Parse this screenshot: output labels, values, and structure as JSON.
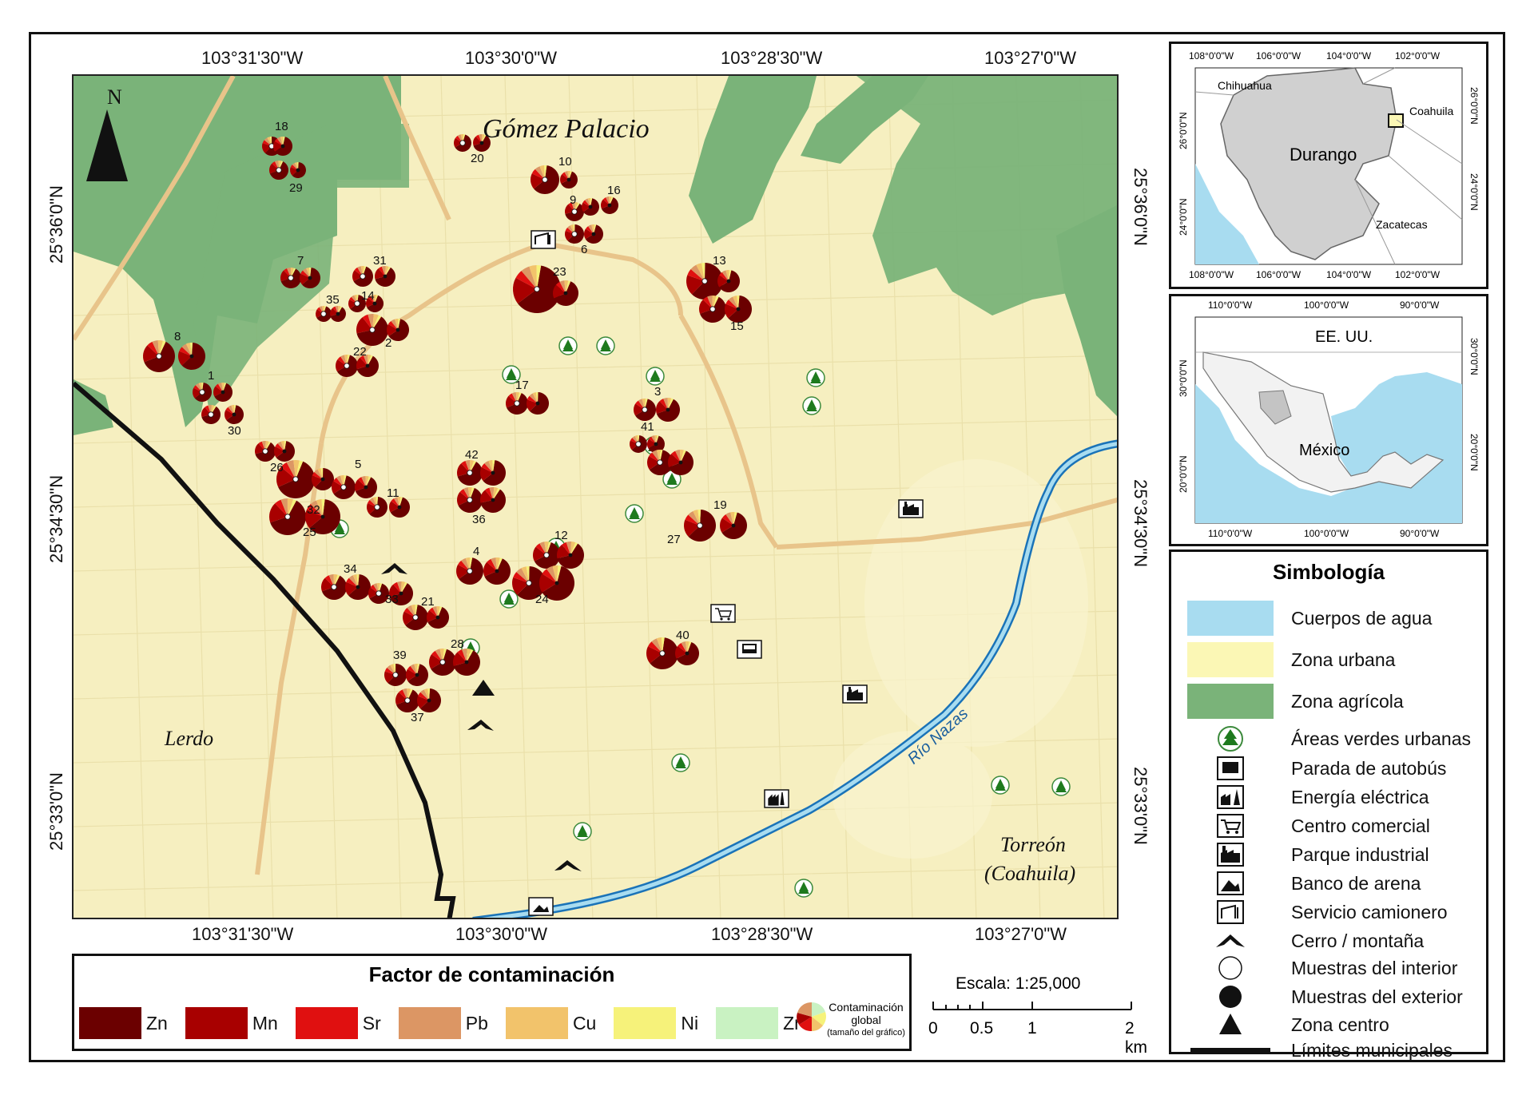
{
  "colors": {
    "water": "#a8dcf0",
    "urban": "#fbf7b5",
    "agri": "#7ab379",
    "zn": "#6b0000",
    "mn": "#a80000",
    "sr": "#e01010",
    "pb": "#dc9664",
    "cu": "#f2c36b",
    "ni": "#f6f27a",
    "zr": "#c9f2c2",
    "border": "#111111",
    "river": "#1a73b8"
  },
  "main_map": {
    "top_coords": [
      "103°31'30\"W",
      "103°30'0\"W",
      "103°28'30\"W",
      "103°27'0\"W"
    ],
    "bottom_coords": [
      "103°31'30\"W",
      "103°30'0\"W",
      "103°28'30\"W",
      "103°27'0\"W"
    ],
    "left_coords": [
      "25°36'0\"N",
      "25°34'30\"N",
      "25°33'0\"N"
    ],
    "right_coords": [
      "25°36'0\"N",
      "25°34'30\"N",
      "25°33'0\"N"
    ],
    "north_label": "N",
    "places": {
      "gomez": "Gómez Palacio",
      "lerdo": "Lerdo",
      "torreon1": "Torreón",
      "torreon2": "(Coahuila)",
      "river": "Río Nazas"
    },
    "site_numbers": [
      "18",
      "29",
      "20",
      "10",
      "9",
      "16",
      "6",
      "7",
      "31",
      "23",
      "13",
      "15",
      "35",
      "14",
      "2",
      "8",
      "22",
      "1",
      "30",
      "17",
      "3",
      "41",
      "26",
      "32",
      "5",
      "11",
      "42",
      "36",
      "27",
      "19",
      "25",
      "12",
      "4",
      "34",
      "33",
      "21",
      "24",
      "39",
      "37",
      "28",
      "40"
    ]
  },
  "inset_durango": {
    "top": [
      "108°0'0\"W",
      "106°0'0\"W",
      "104°0'0\"W",
      "102°0'0\"W"
    ],
    "bottom": [
      "108°0'0\"W",
      "106°0'0\"W",
      "104°0'0\"W",
      "102°0'0\"W"
    ],
    "left": [
      "26°0'0\"N",
      "24°0'0\"N"
    ],
    "right": [
      "26°0'0\"N",
      "24°0'0\"N"
    ],
    "labels": {
      "chihuahua": "Chihuahua",
      "coahuila": "Coahuila",
      "durango": "Durango",
      "zacatecas": "Zacatecas"
    }
  },
  "inset_mexico": {
    "top": [
      "110°0'0\"W",
      "100°0'0\"W",
      "90°0'0\"W"
    ],
    "bottom": [
      "110°0'0\"W",
      "100°0'0\"W",
      "90°0'0\"W"
    ],
    "left": [
      "30°0'0\"N",
      "20°0'0\"N"
    ],
    "right": [
      "30°0'0\"N",
      "20°0'0\"N"
    ],
    "labels": {
      "usa": "EE. UU.",
      "mexico": "México"
    }
  },
  "legend": {
    "title": "Simbología",
    "items": [
      "Cuerpos de agua",
      "Zona urbana",
      "Zona agrícola",
      "Áreas verdes urbanas",
      "Parada de autobús",
      "Energía eléctrica",
      "Centro comercial",
      "Parque industrial",
      "Banco de arena",
      "Servicio camionero",
      "Cerro / montaña",
      "Muestras del interior",
      "Muestras del exterior",
      "Zona centro",
      "Límites municipales"
    ]
  },
  "contamination_legend": {
    "title": "Factor de contaminación",
    "elements": [
      "Zn",
      "Mn",
      "Sr",
      "Pb",
      "Cu",
      "Ni",
      "Zr"
    ],
    "global_label_1": "Contaminación",
    "global_label_2": "global",
    "global_label_3": "(tamaño del gráfico)"
  },
  "scale": {
    "title": "Escala: 1:25,000",
    "ticks": [
      "0",
      "0.5",
      "1",
      "2 km"
    ]
  }
}
